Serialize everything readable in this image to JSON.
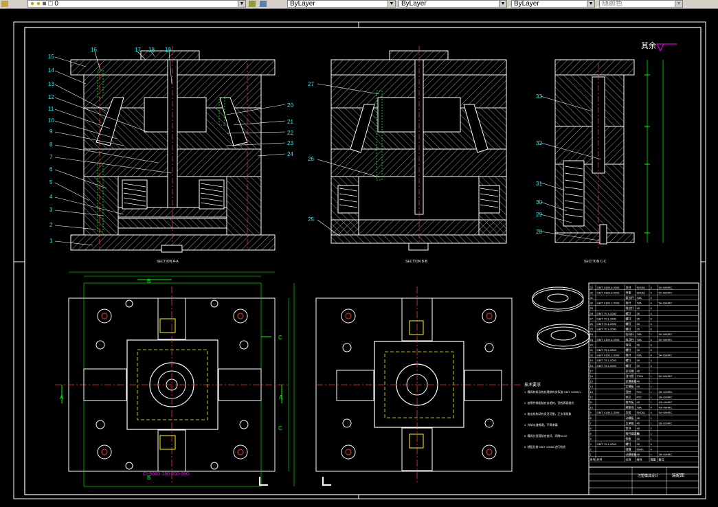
{
  "toolbar": {
    "layer_value": "0",
    "color_value": "ByLayer",
    "linetype_value": "ByLayer",
    "lineweight_value": "ByLayer",
    "plotstyle_value": "随颜色"
  },
  "drawing": {
    "section_aa": "SECTION A-A",
    "section_bb": "SECTION B-B",
    "section_cc": "SECTION C-C",
    "roughness_label": "其余",
    "mold_base_code": "CI-5060-180-200-090",
    "part_labels": [
      "1",
      "2",
      "3",
      "4",
      "5",
      "6",
      "7",
      "8",
      "9",
      "10",
      "11",
      "12",
      "13",
      "14",
      "15",
      "16",
      "17",
      "18",
      "19",
      "20",
      "21",
      "22",
      "23",
      "24",
      "25",
      "26",
      "27",
      "28",
      "29",
      "30",
      "31",
      "32",
      "33"
    ],
    "cut_labels": [
      "A",
      "A",
      "B",
      "B",
      "C",
      "C"
    ],
    "tech_title": "技术要求",
    "tech_lines": [
      "1. 模具材料及热处理按有关标准 GB/T 12555.1",
      "2. 各零件装配前应去毛刺，型腔表面抛光",
      "3. 推出机构动作灵活可靠，无卡滞现象",
      "4. 冷却水道畅通，不得渗漏",
      "5. 模具分型面贴合良好，间隙≤0.02",
      "6. 装配后按 GB/T 12556 进行检验"
    ],
    "title_block_name": "注塑模具设计",
    "title_block_drawing": "装配图",
    "bom_rows": [
      [
        "33",
        "GB/T 4169.4-2006",
        "导柱",
        "SKD61",
        "4",
        "54~58HRC"
      ],
      [
        "32",
        "GB/T 4169.3-2006",
        "导套",
        "SKD61",
        "4",
        "54~58HRC"
      ],
      [
        "31",
        "",
        "复位杆",
        "T8A",
        "4",
        ""
      ],
      [
        "30",
        "GB/T 4169.1-2006",
        "推杆",
        "T8A",
        "4",
        "54~58HRC"
      ],
      [
        "29",
        "",
        "限位钉",
        "45",
        "4",
        ""
      ],
      [
        "28",
        "GB/T 70.1-2000",
        "螺钉",
        "35",
        "4",
        ""
      ],
      [
        "27",
        "GB/T 70.1-2000",
        "螺钉",
        "35",
        "6",
        ""
      ],
      [
        "26",
        "GB/T 70.1-2000",
        "螺钉",
        "35",
        "4",
        ""
      ],
      [
        "25",
        "GB/T 70.1-2000",
        "螺钉",
        "35",
        "6",
        ""
      ],
      [
        "24",
        "",
        "拉料杆",
        "T8A",
        "1",
        "54~58HRC"
      ],
      [
        "23",
        "GB/T 4169.4-2006",
        "斜导柱",
        "T8A",
        "4",
        "54~58HRC"
      ],
      [
        "22",
        "",
        "滑块",
        "45",
        "4",
        ""
      ],
      [
        "21",
        "GB/T 70.1-2000",
        "螺钉",
        "35",
        "8",
        ""
      ],
      [
        "20",
        "GB/T 4169.1-2006",
        "推杆",
        "T8A",
        "8",
        "54~58HRC"
      ],
      [
        "19",
        "GB/T 70.1-2000",
        "螺钉",
        "35",
        "4",
        ""
      ],
      [
        "18",
        "GB/T 70.1-2000",
        "螺钉",
        "35",
        "4",
        ""
      ],
      [
        "17",
        "",
        "定位圈",
        "45",
        "1",
        ""
      ],
      [
        "16",
        "",
        "浇口套",
        "T10A",
        "1",
        "50~55HRC"
      ],
      [
        "15",
        "",
        "定模座板",
        "45",
        "1",
        ""
      ],
      [
        "14",
        "",
        "定模板",
        "45",
        "1",
        ""
      ],
      [
        "13",
        "",
        "型腔",
        "P20",
        "1",
        "28~32HRC"
      ],
      [
        "12",
        "",
        "型芯",
        "P20",
        "1",
        "28~32HRC"
      ],
      [
        "11",
        "",
        "推件板",
        "45",
        "1",
        "43~48HRC"
      ],
      [
        "10",
        "",
        "楔紧块",
        "T8A",
        "4",
        "43~48HRC"
      ],
      [
        "9",
        "GB/T 4169.2-2006",
        "导套",
        "SKD61",
        "4",
        "54~58HRC"
      ],
      [
        "8",
        "",
        "动模板",
        "45",
        "1",
        ""
      ],
      [
        "7",
        "",
        "支承板",
        "45",
        "1",
        "28~32HRC"
      ],
      [
        "6",
        "",
        "垫块",
        "45",
        "2",
        ""
      ],
      [
        "5",
        "",
        "推杆固定板",
        "45",
        "1",
        ""
      ],
      [
        "4",
        "",
        "推板",
        "45",
        "1",
        ""
      ],
      [
        "3",
        "GB/T 70.1-2000",
        "螺钉",
        "35",
        "4",
        ""
      ],
      [
        "2",
        "",
        "弹簧",
        "65Mn",
        "4",
        ""
      ],
      [
        "1",
        "",
        "动模座板",
        "45",
        "1",
        "28~32HRC"
      ]
    ],
    "bom_header": [
      "序号",
      "代号",
      "名称",
      "材料",
      "数量",
      "备注"
    ]
  },
  "colors": {
    "background": "#000000",
    "outline": "#ffffff",
    "hatch": "#ffffff",
    "center": "#ff3030",
    "dim": "#00ff00",
    "label": "#00ffff",
    "highlight": "#ffff00",
    "mold_code": "#ff00ff"
  }
}
